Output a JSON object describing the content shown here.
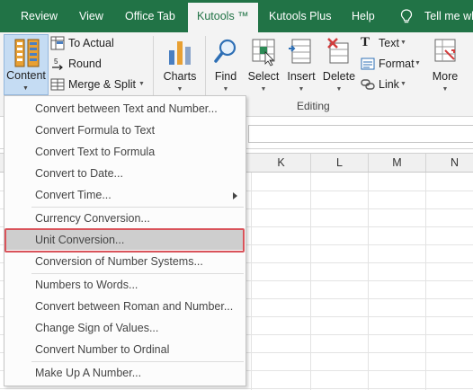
{
  "tabs": {
    "review": "Review",
    "view": "View",
    "office_tab": "Office Tab",
    "kutools": "Kutools ™",
    "kutools_plus": "Kutools Plus",
    "help": "Help",
    "tell_me": "Tell me wh"
  },
  "ribbon": {
    "content": "Content",
    "to_actual": "To Actual",
    "round": "Round",
    "merge_split": "Merge & Split",
    "charts": "Charts",
    "find": "Find",
    "select": "Select",
    "insert": "Insert",
    "delete": "Delete",
    "text": "Text",
    "format": "Format",
    "link": "Link",
    "more": "More",
    "editing_group": "Editing"
  },
  "columns": [
    "K",
    "L",
    "M",
    "N"
  ],
  "menu": {
    "items": [
      "Convert between Text and Number...",
      "Convert Formula to Text",
      "Convert Text to Formula",
      "Convert to Date...",
      "Convert Time...",
      "Currency Conversion...",
      "Unit Conversion...",
      "Conversion of Number Systems...",
      "Numbers to Words...",
      "Convert between Roman and Number...",
      "Change Sign of Values...",
      "Convert Number to Ordinal",
      "Make Up A Number..."
    ],
    "highlighted": "Unit Conversion..."
  },
  "colors": {
    "tab_bar": "#217346",
    "ribbon_bg": "#f3f3f3",
    "content_button_bg": "#c5dcf3",
    "menu_highlight": "#cecece",
    "annotation_box": "#d9535a"
  }
}
